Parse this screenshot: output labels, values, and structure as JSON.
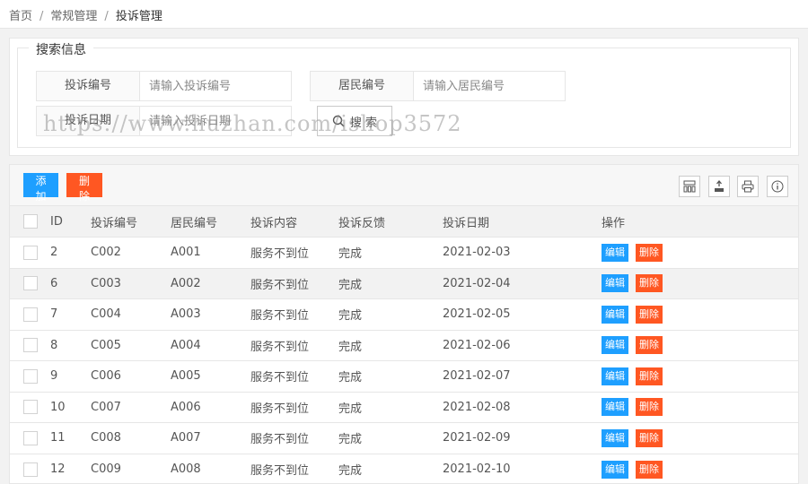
{
  "breadcrumb": [
    "首页",
    "常规管理",
    "投诉管理"
  ],
  "search": {
    "legend": "搜索信息",
    "fields": [
      {
        "label": "投诉编号",
        "placeholder": "请输入投诉编号"
      },
      {
        "label": "居民编号",
        "placeholder": "请输入居民编号"
      },
      {
        "label": "投诉日期",
        "placeholder": "请输入投诉日期"
      }
    ],
    "button_label": "搜 索"
  },
  "watermark": "https://www.huzhan.com/ishop3572",
  "toolbar": {
    "add_label": "添加",
    "delete_label": "删除",
    "icons": [
      "columns-icon",
      "export-icon",
      "print-icon",
      "info-icon"
    ]
  },
  "table": {
    "headers": [
      "ID",
      "投诉编号",
      "居民编号",
      "投诉内容",
      "投诉反馈",
      "投诉日期",
      "操作"
    ],
    "rows": [
      {
        "id": "2",
        "code": "C002",
        "resident": "A001",
        "content": "服务不到位",
        "feedback": "完成",
        "date": "2021-02-03"
      },
      {
        "id": "6",
        "code": "C003",
        "resident": "A002",
        "content": "服务不到位",
        "feedback": "完成",
        "date": "2021-02-04"
      },
      {
        "id": "7",
        "code": "C004",
        "resident": "A003",
        "content": "服务不到位",
        "feedback": "完成",
        "date": "2021-02-05"
      },
      {
        "id": "8",
        "code": "C005",
        "resident": "A004",
        "content": "服务不到位",
        "feedback": "完成",
        "date": "2021-02-06"
      },
      {
        "id": "9",
        "code": "C006",
        "resident": "A005",
        "content": "服务不到位",
        "feedback": "完成",
        "date": "2021-02-07"
      },
      {
        "id": "10",
        "code": "C007",
        "resident": "A006",
        "content": "服务不到位",
        "feedback": "完成",
        "date": "2021-02-08"
      },
      {
        "id": "11",
        "code": "C008",
        "resident": "A007",
        "content": "服务不到位",
        "feedback": "完成",
        "date": "2021-02-09"
      },
      {
        "id": "12",
        "code": "C009",
        "resident": "A008",
        "content": "服务不到位",
        "feedback": "完成",
        "date": "2021-02-10"
      }
    ],
    "edit_label": "编辑",
    "delete_label": "删除"
  },
  "colors": {
    "primary": "#1e9fff",
    "danger": "#ff5722"
  }
}
